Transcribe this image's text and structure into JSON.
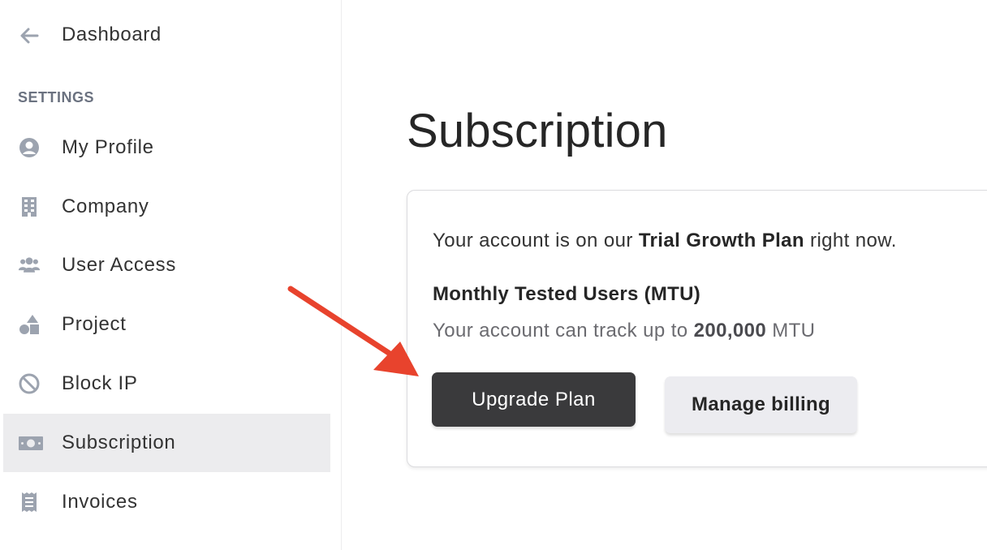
{
  "sidebar": {
    "back_label": "Dashboard",
    "section_label": "SETTINGS",
    "items": [
      {
        "label": "My Profile",
        "icon": "user-circle-icon"
      },
      {
        "label": "Company",
        "icon": "building-icon"
      },
      {
        "label": "User Access",
        "icon": "users-icon"
      },
      {
        "label": "Project",
        "icon": "shapes-icon"
      },
      {
        "label": "Block IP",
        "icon": "ban-icon"
      },
      {
        "label": "Subscription",
        "icon": "money-bill-icon",
        "active": true
      },
      {
        "label": "Invoices",
        "icon": "receipt-icon"
      }
    ]
  },
  "main": {
    "title": "Subscription",
    "plan": {
      "prefix": "Your account is on our ",
      "name": "Trial Growth Plan",
      "suffix": " right now."
    },
    "mtu": {
      "title": "Monthly Tested Users (MTU)",
      "prefix": "Your account can track up to ",
      "value": "200,000",
      "suffix": " MTU"
    },
    "buttons": {
      "upgrade": "Upgrade Plan",
      "manage": "Manage billing"
    }
  },
  "colors": {
    "primary_button": "#3a3a3c",
    "secondary_button": "#ececf0",
    "active_nav": "#ececee",
    "icon": "#9ca3af",
    "annotation_arrow": "#e8432d"
  }
}
